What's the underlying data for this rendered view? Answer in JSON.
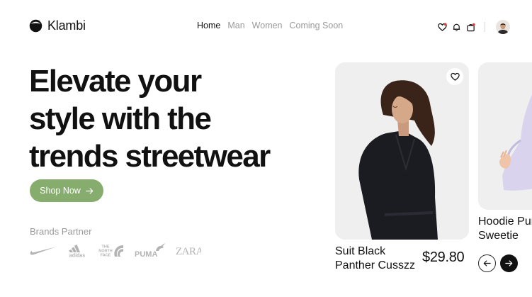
{
  "brand": {
    "name": "Klambi",
    "logo_icon": "circle-logo-icon"
  },
  "nav": {
    "items": [
      "Home",
      "Man",
      "Women",
      "Coming Soon"
    ],
    "active": "Home"
  },
  "header": {
    "icons": [
      "heart-icon",
      "bell-icon",
      "bag-icon"
    ]
  },
  "hero": {
    "title_lines": [
      "Elevate your",
      "style with the",
      "trends streetwear"
    ],
    "cta_label": "Shop Now",
    "cta_color": "#86ad6e"
  },
  "brands": {
    "label": "Brands Partner",
    "items": [
      "nike",
      "adidas",
      "The North Face",
      "PUMA",
      "ZARA"
    ]
  },
  "products": [
    {
      "name_lines": [
        "Suit Black",
        "Panther Cusszz"
      ],
      "price": "$29.80"
    },
    {
      "name_lines": [
        "Hoodie Pur",
        "Sweetie"
      ]
    }
  ],
  "carousel": {
    "controls": [
      "arrow-left-icon",
      "arrow-right-icon"
    ]
  }
}
